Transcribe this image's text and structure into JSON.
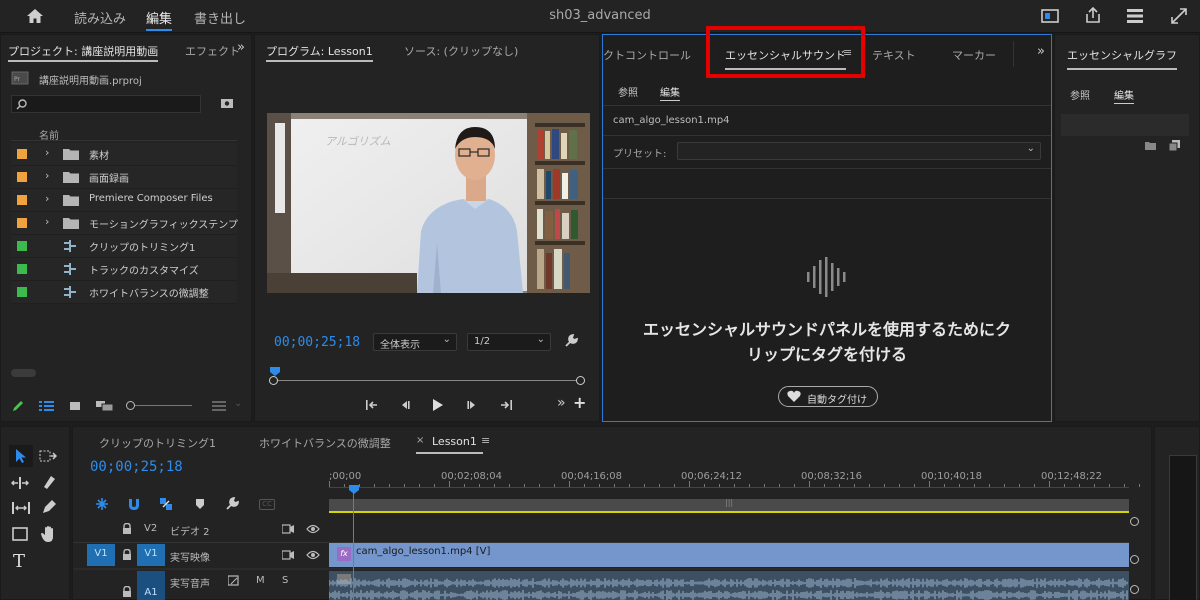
{
  "topbar": {
    "tabs": [
      "読み込み",
      "編集",
      "書き出し"
    ],
    "active_tab": "編集",
    "doc_title": "sh03_advanced"
  },
  "project": {
    "title": "プロジェクト: 講座説明用動画",
    "effects_tab": "エフェクト",
    "filename": "講座説明用動画.prproj",
    "search_value": "",
    "column_header": "名前",
    "items": [
      {
        "label": "素材",
        "type": "folder",
        "color": "#f0a23c"
      },
      {
        "label": "画面録画",
        "type": "folder",
        "color": "#f0a23c"
      },
      {
        "label": "Premiere Composer Files",
        "type": "folder",
        "color": "#f0a23c"
      },
      {
        "label": "モーショングラフィックステンプレ",
        "type": "folder",
        "color": "#f0a23c"
      },
      {
        "label": "クリップのトリミング1",
        "type": "sequence",
        "color": "#3dba4e"
      },
      {
        "label": "トラックのカスタマイズ",
        "type": "sequence",
        "color": "#3dba4e"
      },
      {
        "label": "ホワイトバランスの微調整",
        "type": "sequence",
        "color": "#3dba4e"
      }
    ]
  },
  "program": {
    "title": "プログラム: Lesson1",
    "source_tab": "ソース: (クリップなし)",
    "whiteboard_text": "アルゴリズム",
    "timecode": "00;00;25;18",
    "fit_select": "全体表示",
    "quality_select": "1/2"
  },
  "essential_sound": {
    "tabs": [
      "クトコントロール",
      "エッセンシャルサウンド",
      "テキスト",
      "マーカー"
    ],
    "active_tab": "エッセンシャルサウンド",
    "subtabs": [
      "参照",
      "編集"
    ],
    "active_subtab": "編集",
    "clip_name": "cam_algo_lesson1.mp4",
    "preset_label": "プリセット:",
    "preset_value": "",
    "message": "エッセンシャルサウンドパネルを使用するためにクリップにタグを付ける",
    "message_line1": "エッセンシャルサウンドパネルを使用するためにク",
    "message_line2": "リップにタグを付ける",
    "autotag_button": "自動タグ付け",
    "highlight_color": "#e50000"
  },
  "essential_graphics": {
    "title": "エッセンシャルグラフ",
    "subtabs": [
      "参照",
      "編集"
    ]
  },
  "timeline": {
    "tabs": [
      "クリップのトリミング1",
      "ホワイトバランスの微調整",
      "Lesson1"
    ],
    "active_tab": "Lesson1",
    "timecode": "00;00;25;18",
    "ruler": [
      ";00;00",
      "00;02;08;04",
      "00;04;16;08",
      "00;06;24;12",
      "00;08;32;16",
      "00;10;40;18",
      "00;12;48;22"
    ],
    "tracks": [
      {
        "id": "V2",
        "name": "ビデオ 2",
        "source": ""
      },
      {
        "id": "V1",
        "name": "実写映像",
        "source": "V1"
      },
      {
        "id": "A1",
        "name": "実写音声",
        "source": ""
      }
    ],
    "clip_label": "cam_algo_lesson1.mp4 [V]",
    "clip_fx": "fx",
    "audio_mute": "M",
    "audio_solo": "S",
    "playhead_color": "#2d8ceb"
  }
}
